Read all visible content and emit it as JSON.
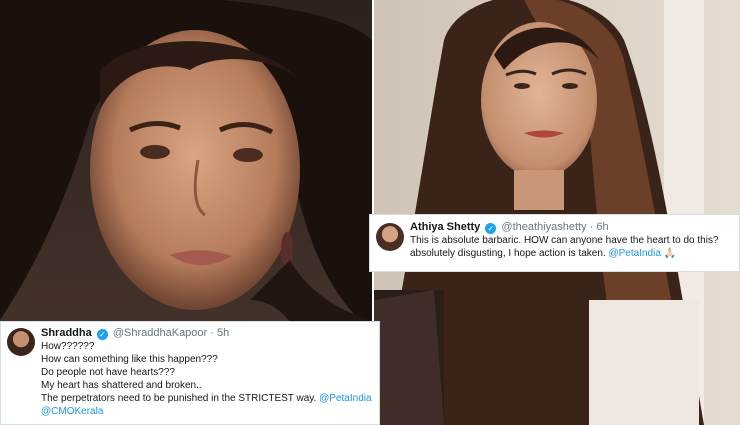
{
  "colors": {
    "link": "#1b95e0",
    "verified": "#1da1f2",
    "meta": "#657786",
    "text": "#14171a"
  },
  "tweets": [
    {
      "name": "Shraddha",
      "handle": "@ShraddhaKapoor",
      "time": "5h",
      "verified_icon": "check-icon",
      "lines": [
        "How??????",
        "How can something like this happen???",
        "Do people not have hearts???",
        "My heart has shattered and broken..",
        "The perpetrators need to be punished in the STRICTEST way."
      ],
      "mention1": "@PetaIndia",
      "mention2": "@CMOKerala"
    },
    {
      "name": "Athiya Shetty",
      "handle": "@theathiyashetty",
      "time": "6h",
      "verified_icon": "check-icon",
      "line1": "This is absolute barbaric. HOW can anyone have the heart to do this?",
      "line2": "absolutely disgusting, I hope action is taken.",
      "mention": "@PetaIndia",
      "emoji": "🙏🏻"
    }
  ]
}
